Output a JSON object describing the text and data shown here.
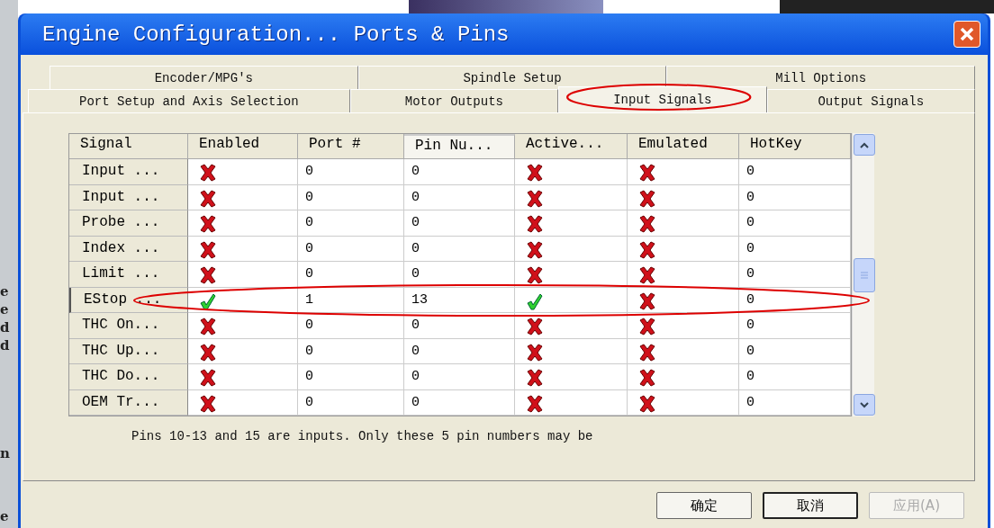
{
  "background_letters": [
    "e",
    "e",
    "d",
    "d",
    "n",
    "e"
  ],
  "window": {
    "title": "Engine Configuration... Ports & Pins"
  },
  "tab_rows": [
    [
      {
        "label": "Encoder/MPG's",
        "selected": false
      },
      {
        "label": "Spindle Setup",
        "selected": false
      },
      {
        "label": "Mill Options",
        "selected": false
      }
    ],
    [
      {
        "label": "Port Setup and Axis Selection",
        "selected": false
      },
      {
        "label": "Motor Outputs",
        "selected": false
      },
      {
        "label": "Input Signals",
        "selected": true
      },
      {
        "label": "Output Signals",
        "selected": false
      }
    ]
  ],
  "table": {
    "columns": [
      "Signal",
      "Enabled",
      "Port #",
      "Pin Nu...",
      "Active...",
      "Emulated",
      "HotKey"
    ],
    "rows": [
      {
        "signal": "Input ...",
        "enabled": false,
        "port": "0",
        "pin": "0",
        "active": false,
        "emulated": false,
        "hotkey": "0",
        "selected": false
      },
      {
        "signal": "Input ...",
        "enabled": false,
        "port": "0",
        "pin": "0",
        "active": false,
        "emulated": false,
        "hotkey": "0",
        "selected": false
      },
      {
        "signal": "Probe ...",
        "enabled": false,
        "port": "0",
        "pin": "0",
        "active": false,
        "emulated": false,
        "hotkey": "0",
        "selected": false
      },
      {
        "signal": "Index ...",
        "enabled": false,
        "port": "0",
        "pin": "0",
        "active": false,
        "emulated": false,
        "hotkey": "0",
        "selected": false
      },
      {
        "signal": "Limit ...",
        "enabled": false,
        "port": "0",
        "pin": "0",
        "active": false,
        "emulated": false,
        "hotkey": "0",
        "selected": false
      },
      {
        "signal": "EStop ...",
        "enabled": true,
        "port": "1",
        "pin": "13",
        "active": true,
        "emulated": false,
        "hotkey": "0",
        "selected": true
      },
      {
        "signal": "THC On...",
        "enabled": false,
        "port": "0",
        "pin": "0",
        "active": false,
        "emulated": false,
        "hotkey": "0",
        "selected": false
      },
      {
        "signal": "THC Up...",
        "enabled": false,
        "port": "0",
        "pin": "0",
        "active": false,
        "emulated": false,
        "hotkey": "0",
        "selected": false
      },
      {
        "signal": "THC Do...",
        "enabled": false,
        "port": "0",
        "pin": "0",
        "active": false,
        "emulated": false,
        "hotkey": "0",
        "selected": false
      },
      {
        "signal": "OEM Tr...",
        "enabled": false,
        "port": "0",
        "pin": "0",
        "active": false,
        "emulated": false,
        "hotkey": "0",
        "selected": false
      }
    ]
  },
  "note": "Pins 10-13 and 15 are inputs. Only these 5 pin numbers may be",
  "buttons": [
    {
      "label": "确定",
      "disabled": false
    },
    {
      "label": "取消",
      "disabled": false
    },
    {
      "label": "应用(A)",
      "disabled": true
    }
  ]
}
